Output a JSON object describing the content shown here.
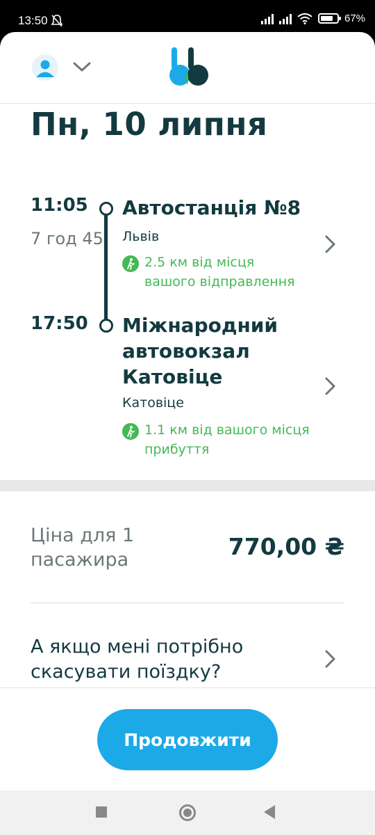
{
  "status_bar": {
    "time": "13:50",
    "battery": "67%"
  },
  "trip": {
    "date_title": "Пн, 10 липня",
    "departure": {
      "time": "11:05",
      "duration": "7 год 45",
      "stop_name": "Автостанція №8",
      "city": "Львів",
      "walk_line1": "2.5 км від місця",
      "walk_line2": "вашого відправлення"
    },
    "arrival": {
      "time": "17:50",
      "stop_line1": "Міжнародний",
      "stop_line2": "автовокзал",
      "stop_line3": "Катовіце",
      "city": "Катовіце",
      "walk_line1": "1.1 км від вашого місця",
      "walk_line2": "прибуття"
    }
  },
  "price": {
    "label_line1": "Ціна для 1",
    "label_line2": "пасажира",
    "value": "770,00 ₴"
  },
  "cancel": {
    "line1": "А якщо мені потрібно",
    "line2": "скасувати поїздку?"
  },
  "actions": {
    "continue_label": "Продовжити"
  },
  "colors": {
    "primary": "#133a40",
    "accent": "#1ca9e8",
    "walk": "#44b955"
  },
  "icons": [
    "avatar-icon",
    "chevron-down-icon",
    "logo-icon",
    "walk-icon",
    "chevron-right-icon"
  ]
}
